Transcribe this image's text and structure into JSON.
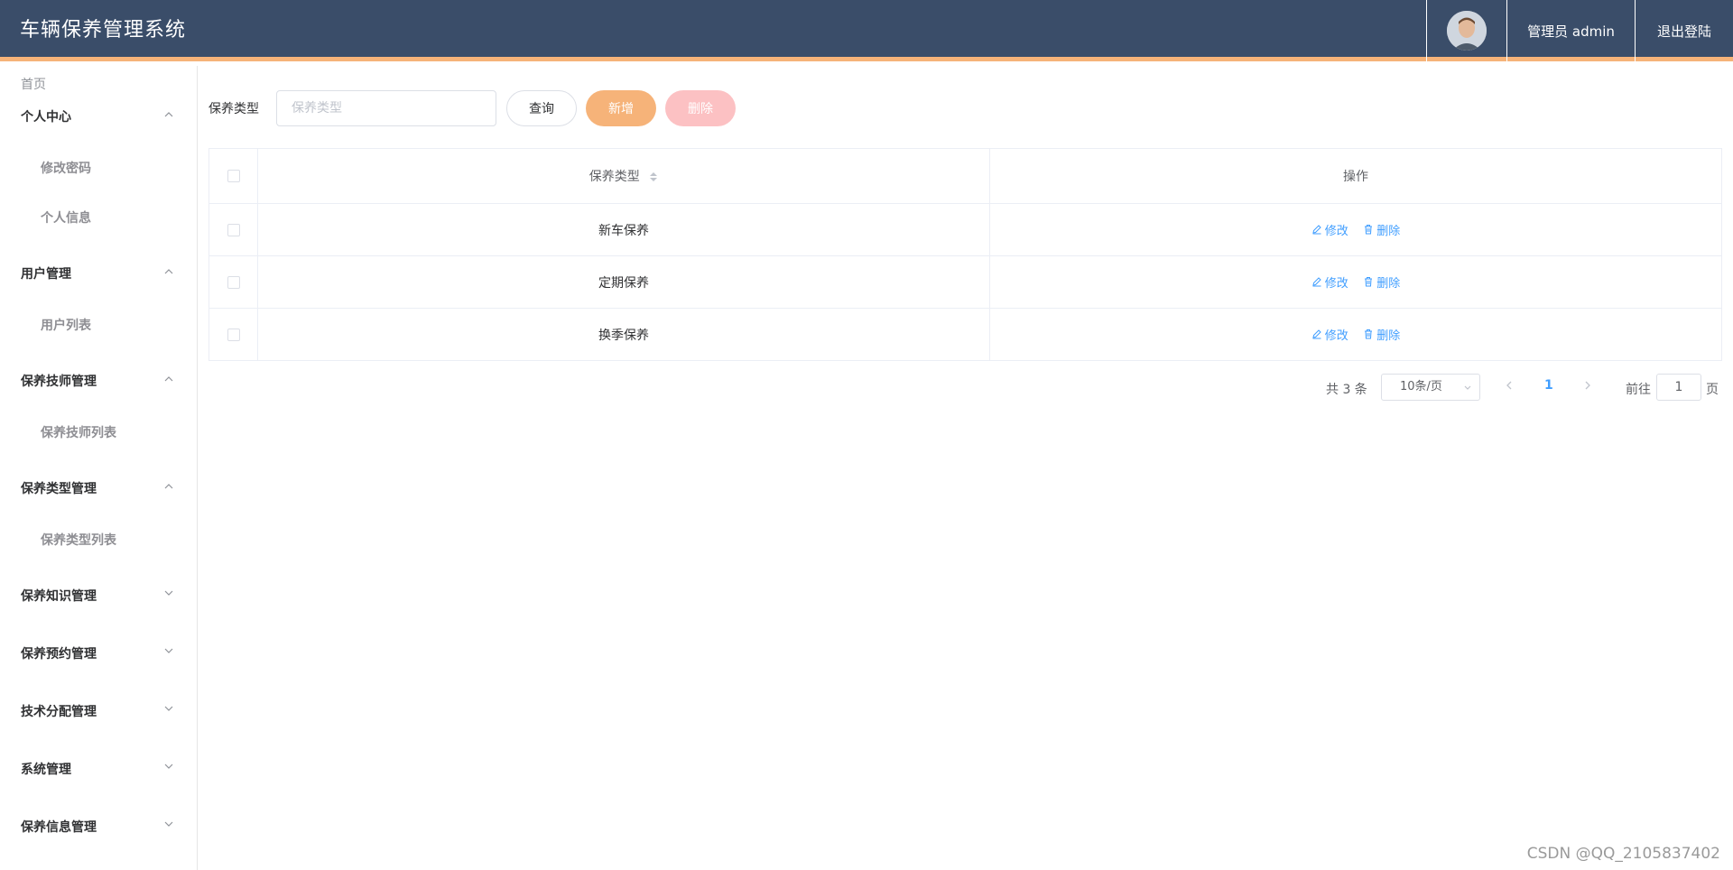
{
  "header": {
    "title": "车辆保养管理系统",
    "user_label": "管理员 admin",
    "logout_label": "退出登陆"
  },
  "sidebar": {
    "home": "首页",
    "groups": [
      {
        "title": "个人中心",
        "expanded": true,
        "items": [
          "修改密码",
          "个人信息"
        ]
      },
      {
        "title": "用户管理",
        "expanded": true,
        "items": [
          "用户列表"
        ]
      },
      {
        "title": "保养技师管理",
        "expanded": true,
        "items": [
          "保养技师列表"
        ]
      },
      {
        "title": "保养类型管理",
        "expanded": true,
        "items": [
          "保养类型列表"
        ]
      },
      {
        "title": "保养知识管理",
        "expanded": false,
        "items": []
      },
      {
        "title": "保养预约管理",
        "expanded": false,
        "items": []
      },
      {
        "title": "技术分配管理",
        "expanded": false,
        "items": []
      },
      {
        "title": "系统管理",
        "expanded": false,
        "items": []
      },
      {
        "title": "保养信息管理",
        "expanded": false,
        "items": []
      }
    ]
  },
  "search": {
    "label": "保养类型",
    "placeholder": "保养类型",
    "value": ""
  },
  "toolbar": {
    "query_label": "查询",
    "add_label": "新增",
    "delete_label": "删除"
  },
  "table": {
    "columns": [
      "保养类型",
      "操作"
    ],
    "rows": [
      {
        "type": "新车保养",
        "edit": "修改",
        "delete": "删除"
      },
      {
        "type": "定期保养",
        "edit": "修改",
        "delete": "删除"
      },
      {
        "type": "换季保养",
        "edit": "修改",
        "delete": "删除"
      }
    ]
  },
  "pagination": {
    "total_text": "共 3 条",
    "page_size": "10条/页",
    "current_page": "1",
    "goto_label": "前往",
    "goto_value": "1",
    "page_unit": "页"
  },
  "watermark": "CSDN @QQ_2105837402",
  "colors": {
    "header_bg": "#3a4d69",
    "accent": "#f6b379",
    "delete_btn": "#fcc1c3",
    "link": "#409eff"
  }
}
